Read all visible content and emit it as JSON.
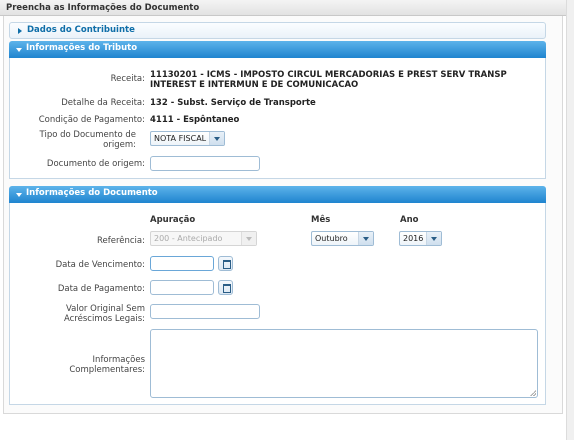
{
  "page": {
    "title": "Preencha as Informações do Documento"
  },
  "contribuinte": {
    "title": "Dados do Contribuinte"
  },
  "tributo": {
    "title": "Informações do Tributo",
    "receita_label": "Receita:",
    "receita_value": "11130201 - ICMS - IMPOSTO CIRCUL MERCADORIAS E PREST SERV TRANSP INTEREST E INTERMUN E DE COMUNICACAO",
    "detalhe_label": "Detalhe da Receita:",
    "detalhe_value": "132 - Subst. Serviço de Transporte",
    "condicao_label": "Condição de Pagamento:",
    "condicao_value": "4111 - Espôntaneo",
    "tipo_label": "Tipo do Documento de origem:",
    "tipo_value": "NOTA FISCAL",
    "documento_label": "Documento de origem:",
    "documento_value": ""
  },
  "documento": {
    "title": "Informações do Documento",
    "col_apuracao": "Apuração",
    "col_mes": "Mês",
    "col_ano": "Ano",
    "referencia_label": "Referência:",
    "apuracao_value": "200 - Antecipado",
    "mes_value": "Outubro",
    "ano_value": "2016",
    "vencimento_label": "Data de Vencimento:",
    "vencimento_value": "",
    "pagamento_label": "Data de Pagamento:",
    "pagamento_value": "",
    "valor_label": "Valor Original Sem Acréscimos Legais:",
    "valor_value": "",
    "info_label": "Informações Complementares:",
    "info_value": ""
  }
}
